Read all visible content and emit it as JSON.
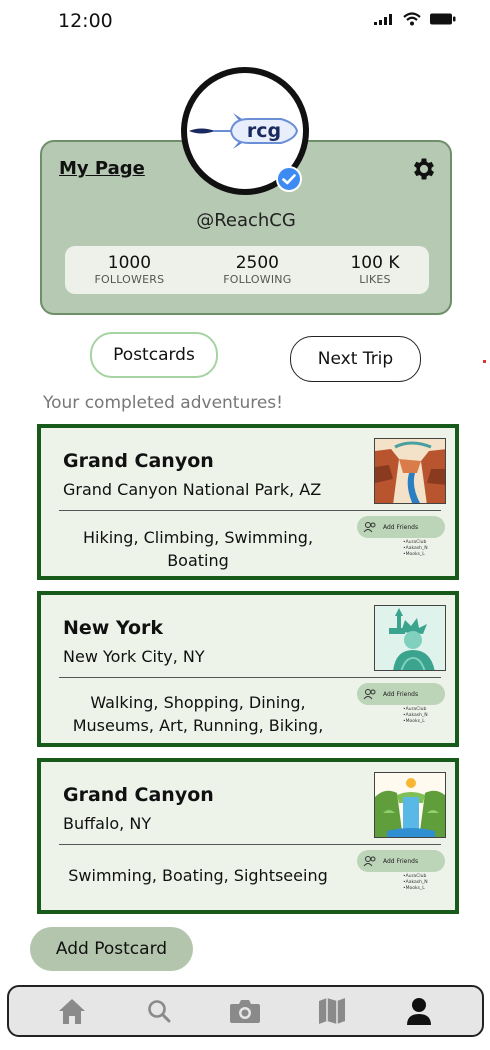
{
  "status_bar": {
    "time": "12:00",
    "icons": [
      "signal-icon",
      "wifi-icon",
      "battery-icon"
    ]
  },
  "profile": {
    "logo_text": "rcg",
    "page_title": "My Page",
    "handle": "@ReachCG",
    "verified": true,
    "stats": [
      {
        "value": "1000",
        "label": "FOLLOWERS"
      },
      {
        "value": "2500",
        "label": "FOLLOWING"
      },
      {
        "value": "100 K",
        "label": "LIKES"
      }
    ]
  },
  "tabs": {
    "postcards": "Postcards",
    "next_trip": "Next Trip",
    "active": "Postcards"
  },
  "subtitle": "Your completed adventures!",
  "postcards": [
    {
      "title": "Grand Canyon",
      "location": "Grand Canyon National Park, AZ",
      "activities": "Hiking, Climbing, Swimming,\nBoating",
      "add_friends_label": "Add Friends",
      "friends": [
        "AuraClub",
        "Aakash_N",
        "Mooks_L"
      ],
      "image_icon": "canyon-image"
    },
    {
      "title": "New York",
      "location": "New York City, NY",
      "activities": "Walking, Shopping, Dining,\nMuseums, Art, Running, Biking,",
      "add_friends_label": "Add Friends",
      "friends": [
        "AuraClub",
        "Aakash_N",
        "Mooks_L"
      ],
      "image_icon": "statue-of-liberty-image"
    },
    {
      "title": "Grand Canyon",
      "location": "Buffalo, NY",
      "activities": "Swimming, Boating, Sightseeing",
      "add_friends_label": "Add Friends",
      "friends": [
        "AuraClub",
        "Aakash_N",
        "Mooks_L"
      ],
      "image_icon": "waterfall-image"
    }
  ],
  "add_postcard_label": "Add Postcard",
  "bottom_nav": [
    {
      "icon": "home-icon",
      "active": false
    },
    {
      "icon": "search-icon",
      "active": false
    },
    {
      "icon": "camera-icon",
      "active": false
    },
    {
      "icon": "map-icon",
      "active": false
    },
    {
      "icon": "profile-icon",
      "active": true
    }
  ],
  "colors": {
    "card_green": "#b6c9b2",
    "postcard_border": "#175a1a",
    "postcard_bg": "#eef3ea",
    "tab_active_border": "#a5d3a2",
    "nav_inactive": "#8a8a8a",
    "nav_active": "#111111"
  }
}
